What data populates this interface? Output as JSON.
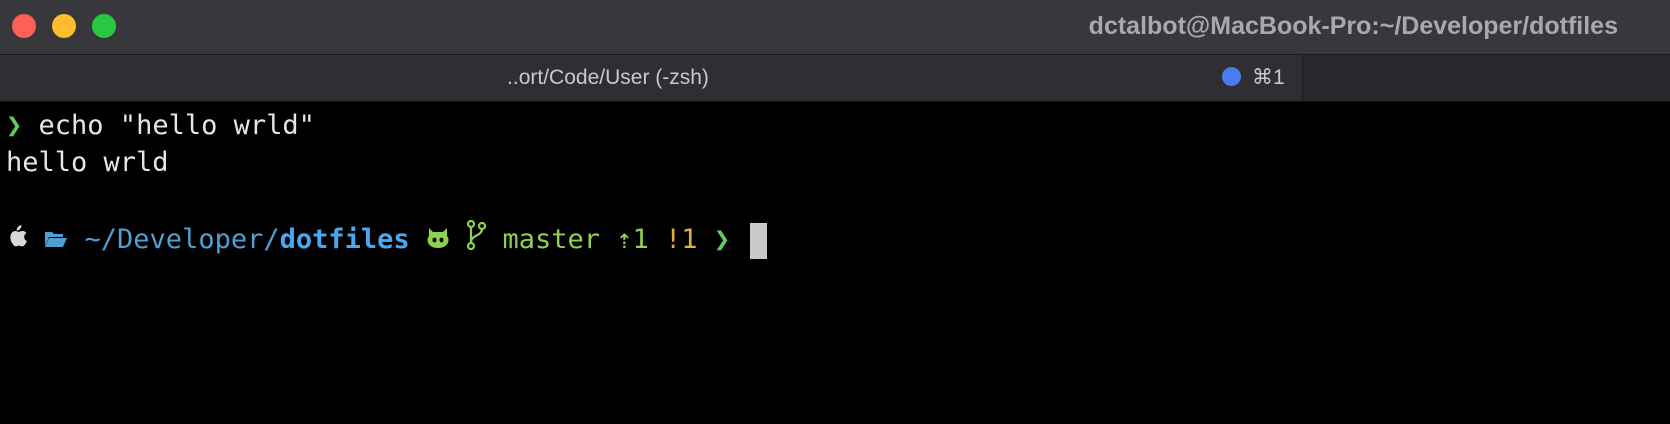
{
  "window": {
    "title": "dctalbot@MacBook-Pro:~/Developer/dotfiles"
  },
  "tab": {
    "title": "..ort/Code/User (-zsh)",
    "shortcut": "⌘1",
    "dot_color": "#4a7cf0"
  },
  "terminal": {
    "prompt1_symbol": "❯",
    "command": "echo \"hello wrld\"",
    "output": "hello wrld",
    "prompt2": {
      "os_icon": "apple-icon",
      "folder_icon": "folder-open-icon",
      "path_prefix": "~/Developer/",
      "path_dir": "dotfiles",
      "github_icon": "github-icon",
      "branch_icon": "git-branch-icon",
      "branch": "master",
      "ahead": "⇡1",
      "dirty": "!1",
      "symbol": "❯"
    }
  },
  "colors": {
    "prompt_green": "#5ed05d",
    "path_blue": "#4aa8f0",
    "branch_green": "#8fd14f",
    "dirty_yellow": "#e0b03a"
  }
}
